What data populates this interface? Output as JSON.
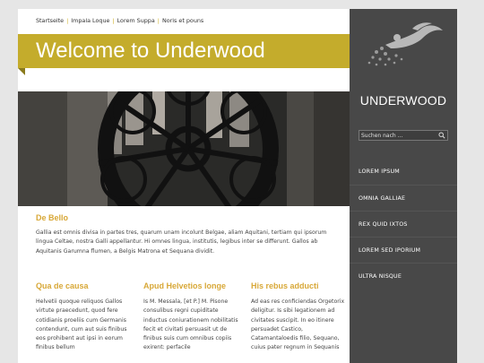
{
  "breadcrumb": [
    "Startseite",
    "Impala Loque",
    "Lorem Suppa",
    "Noris et pouns"
  ],
  "banner": {
    "title": "Welcome to Underwood"
  },
  "hero": {
    "alt": "Rose window viewed from inside a cathedral tower"
  },
  "intro": {
    "title": "De Bello",
    "text": "Gallia est omnis divisa in partes tres, quarum unam incolunt Belgae, aliam Aquitani, tertiam qui ipsorum lingua Celtae, nostra Galli appellantur. Hi omnes lingua, institutis, legibus inter se differunt. Gallos ab Aquitanis Garumna flumen, a Belgis Matrona et Sequana dividit."
  },
  "columns": [
    {
      "title": "Qua de causa",
      "text": "Helvetii quoque reliquos Gallos virtute praecedunt, quod fere cotidianis proeliis cum Germanis contendunt, cum aut suis finibus eos prohibent aut ipsi in eorum finibus bellum"
    },
    {
      "title": "Apud Helvetios longe",
      "text": "Is M. Messala, [et P.] M. Pisone consulibus regni cupiditate inductus coniurationem nobilitatis fecit et civitati persuasit ut de finibus suis cum omnibus copiis exirent: perfacile"
    },
    {
      "title": "His rebus adducti",
      "text": "Ad eas res conficiendas Orgetorix deligitur. Is sibi legationem ad civitates suscipit. In eo itinere persuadet Castico, Catamantaloedis filio, Sequano, cuius pater regnum in Sequanis"
    }
  ],
  "sidebar": {
    "brand": "UNDERWOOD",
    "search_placeholder": "Suchen nach ...",
    "nav": [
      "LOREM IPSUM",
      "OMNIA GALLIAE",
      "REX QUID IXTOS",
      "LOREM SED IPORIUM",
      "ULTRA NISQUE"
    ]
  },
  "colors": {
    "accent": "#c4ac2c",
    "heading": "#d8a838",
    "sidebar": "#484848"
  }
}
